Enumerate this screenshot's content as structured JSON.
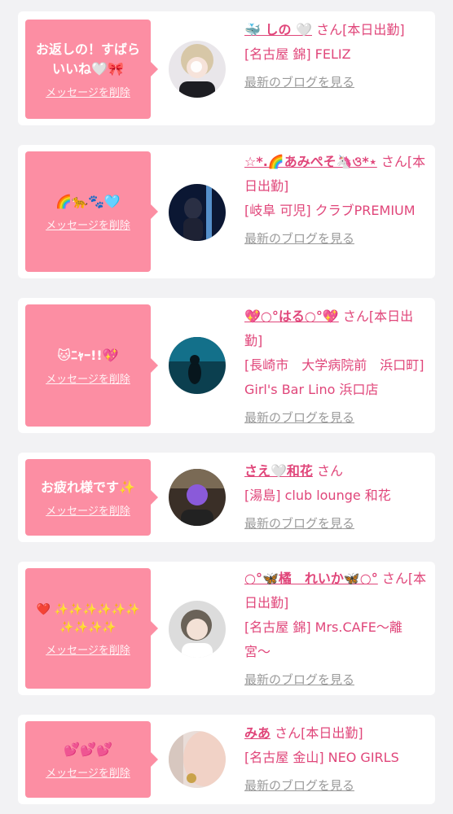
{
  "delete_label": "メッセージを削除",
  "blog_label": "最新のブログを見る",
  "san": "さん",
  "cards": [
    {
      "message": "お返しの！すばらいいね🤍🎀",
      "name": "🐳 しの 🤍",
      "status": "[本日出勤]",
      "store": "[名古屋 錦] FELIZ"
    },
    {
      "message": "🌈🐆🐾🩵",
      "name": "☆*.🌈あみぺそ🦄ও*⋆",
      "status": "[本日出勤]",
      "store": "[岐阜 可児] クラブPREMIUM"
    },
    {
      "message": "🐱ﾆｬｰ!!💖",
      "name": "💖○°はる○°💖",
      "status": "[本日出勤]",
      "store": "[長崎市　大学病院前　浜口町] Girl's Bar Lino 浜口店"
    },
    {
      "message": "お疲れ様です✨",
      "name": "さえ🤍和花",
      "status": "",
      "store": "[湯島] club lounge 和花"
    },
    {
      "message": "❤️ ✨✨✨✨✨✨ ✨✨✨✨",
      "name": "○°🦋橘　れいか🦋○°",
      "status": "[本日出勤]",
      "store": "[名古屋 錦] Mrs.CAFE〜離宮〜"
    },
    {
      "message": "💕💕💕",
      "name": "みあ",
      "status": "[本日出勤]",
      "store": "[名古屋 金山] NEO GIRLS"
    }
  ],
  "colors": {
    "bubble": "#fc8ea3",
    "accent": "#e0467a",
    "link_gray": "#9a9a9a",
    "background": "#f2f2f4"
  }
}
